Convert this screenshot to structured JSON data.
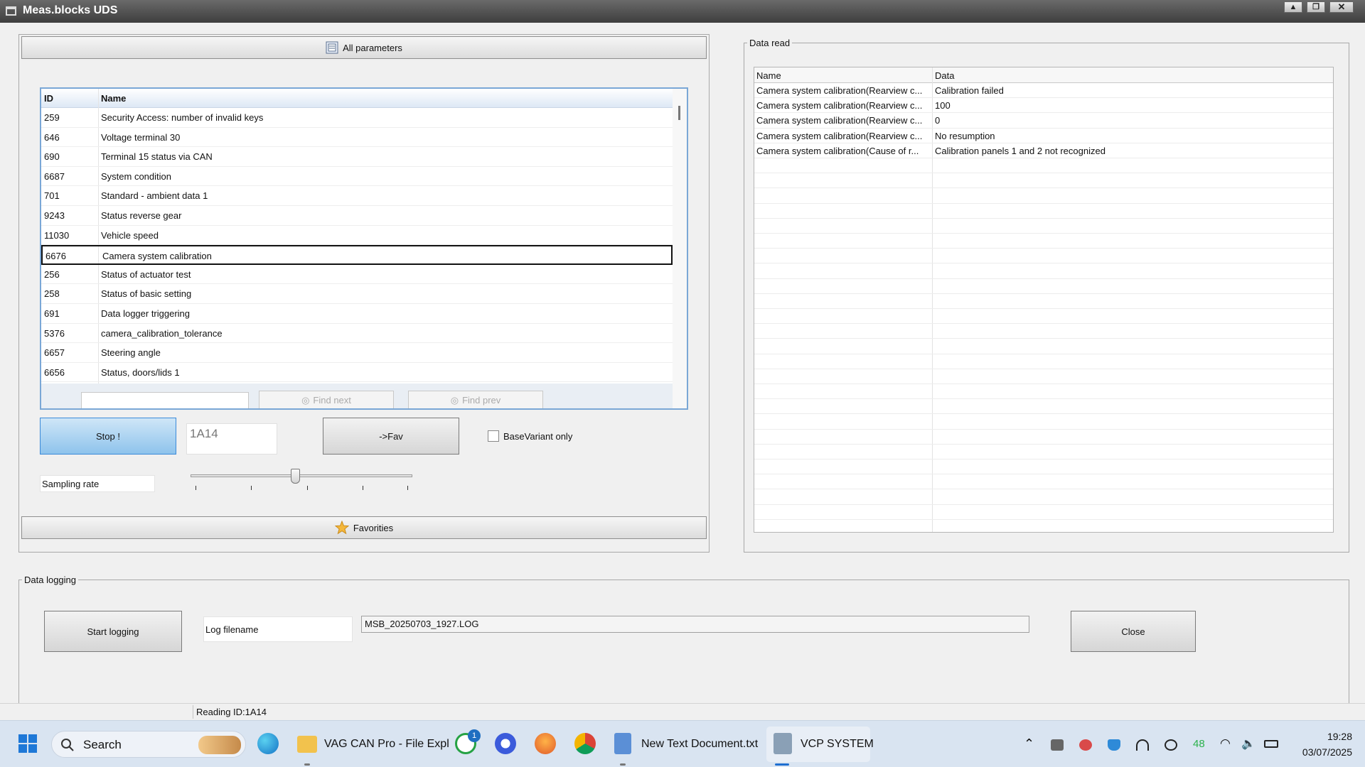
{
  "window": {
    "title": "Meas.blocks UDS",
    "minimize_glyph": "▲",
    "restore_glyph": "❐",
    "close_glyph": "✕"
  },
  "left_panel": {
    "all_parameters_label": "All parameters",
    "list": {
      "columns": [
        "ID",
        "Name"
      ],
      "rows": [
        {
          "id": "259",
          "name": "Security Access: number of invalid keys"
        },
        {
          "id": "646",
          "name": "Voltage terminal 30"
        },
        {
          "id": "690",
          "name": "Terminal 15 status via CAN"
        },
        {
          "id": "6687",
          "name": "System condition"
        },
        {
          "id": "701",
          "name": "Standard - ambient data 1"
        },
        {
          "id": "9243",
          "name": "Status reverse gear"
        },
        {
          "id": "11030",
          "name": "Vehicle speed"
        },
        {
          "id": "6676",
          "name": "Camera system calibration"
        },
        {
          "id": "256",
          "name": "Status of actuator test"
        },
        {
          "id": "258",
          "name": "Status of basic setting"
        },
        {
          "id": "691",
          "name": "Data logger triggering"
        },
        {
          "id": "5376",
          "name": "camera_calibration_tolerance"
        },
        {
          "id": "6657",
          "name": "Steering angle"
        },
        {
          "id": "6656",
          "name": "Status, doors/lids 1"
        }
      ],
      "selected_index": 7,
      "find_next_label": "Find next",
      "find_prev_label": "Find prev"
    },
    "stop_label": "Stop !",
    "id_value": "1A14",
    "fav_label": "->Fav",
    "basevariant_label": "BaseVariant only",
    "sampling_rate_label": "Sampling rate",
    "slider_level": 0.47,
    "favorites_label": "Favorities"
  },
  "data_read": {
    "legend": "Data read",
    "columns": [
      "Name",
      "Data"
    ],
    "rows": [
      {
        "name": "Camera system calibration(Rearview c...",
        "data": "Calibration failed"
      },
      {
        "name": "Camera system calibration(Rearview c...",
        "data": "100"
      },
      {
        "name": "Camera system calibration(Rearview c...",
        "data": "0"
      },
      {
        "name": "Camera system calibration(Rearview c...",
        "data": "No resumption"
      },
      {
        "name": "Camera system calibration(Cause of r...",
        "data": "Calibration panels 1 and 2 not recognized"
      }
    ]
  },
  "data_logging": {
    "legend": "Data logging",
    "start_label": "Start logging",
    "log_filename_label": "Log filename",
    "log_filename_value": "MSB_20250703_1927.LOG",
    "close_label": "Close"
  },
  "status_bar": {
    "text": "Reading ID:1A14"
  },
  "taskbar": {
    "search_label": "Search",
    "file_explorer_label": "VAG CAN Pro - File Expl",
    "whatsapp_badge": "1",
    "notepad_label": "New Text Document.txt",
    "vcp_label": "VCP SYSTEM",
    "tray_number": "48",
    "time": "19:28",
    "date": "03/07/2025"
  },
  "colors": {
    "accent_blue": "#8ec3ec",
    "list_border": "#7aa7d6",
    "taskbar_bg": "#d9e4f1"
  }
}
